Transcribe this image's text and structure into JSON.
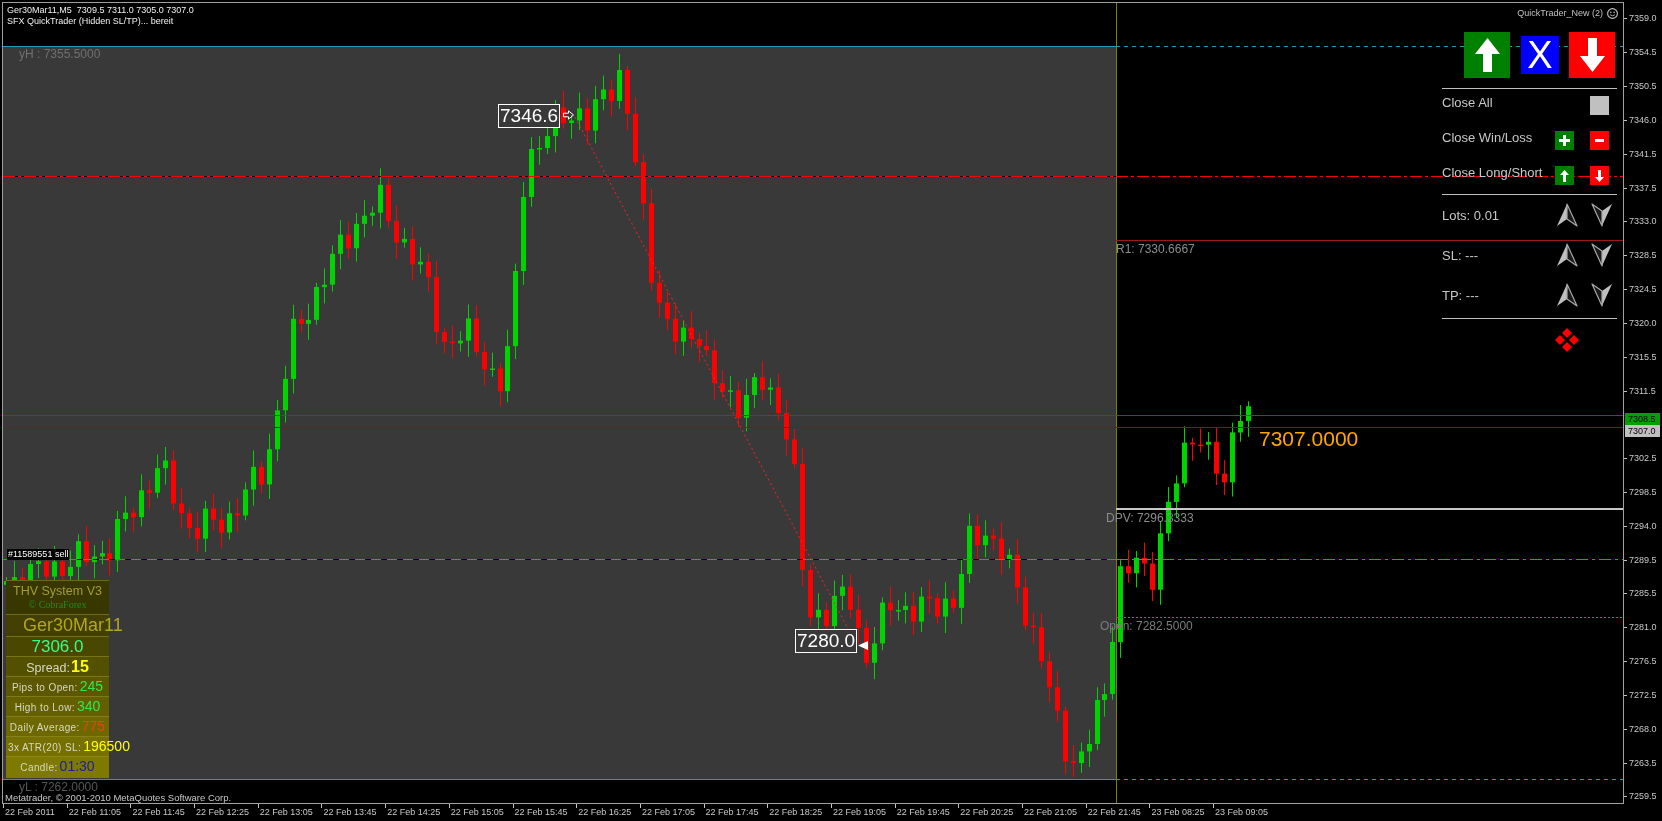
{
  "chart": {
    "title": "Ger30Mar11,M5  7309.5 7311.0 7305.0 7307.0",
    "status": "SFX QuickTrader (Hidden SL/TP)... bereit"
  },
  "quicktrader": {
    "title": "QuickTrader_New (2)",
    "close_label": "X",
    "rows": [
      {
        "kind": "close_all",
        "label": "Close All"
      },
      {
        "kind": "close_win_loss",
        "label": "Close Win/Loss"
      },
      {
        "kind": "close_long_short",
        "label": "Close Long/Short"
      },
      {
        "kind": "stepper",
        "label": "Lots: 0.01"
      },
      {
        "kind": "stepper",
        "label": "SL: ---"
      },
      {
        "kind": "stepper",
        "label": "TP: ---"
      }
    ]
  },
  "level_labels": [
    {
      "kind": "high",
      "label": "yH : 7355.5000"
    },
    {
      "kind": "r1",
      "label": "R1: 7330.6667"
    },
    {
      "kind": "dpv",
      "label": "DPV: 7296.3333"
    },
    {
      "kind": "open",
      "label": "Open: 7282.5000"
    },
    {
      "kind": "low",
      "label": "yL : 7262.0000"
    }
  ],
  "trade_marks": [
    {
      "kind": "entry",
      "label": "7346.6"
    },
    {
      "kind": "exit",
      "label": "7280.0"
    }
  ],
  "current_price": "7307.0000",
  "order_label": "#11589551 sell",
  "thv": {
    "title": "THV System V3",
    "subtitle": "© CobraForex",
    "symbol": "Ger30Mar11",
    "price": "7306.0",
    "rows": [
      {
        "kind": "major",
        "label": "Spread:",
        "value": "15",
        "color": "#ffff00"
      },
      {
        "kind": "stat",
        "label": "Pips to Open:",
        "value": "245",
        "color": "#32e650"
      },
      {
        "kind": "stat",
        "label": "High to Low:",
        "value": "340",
        "color": "#32e650"
      },
      {
        "kind": "stat",
        "label": "Daily Average:",
        "value": "775",
        "color": "#e8431a"
      },
      {
        "kind": "stat",
        "label": "3x ATR(20) SL:",
        "value": "196500",
        "color": "#ffff00"
      },
      {
        "kind": "stat",
        "label": "Candle:",
        "value": "01:30",
        "color": "#1c1c9c"
      }
    ]
  },
  "copyright": "Metatrader, © 2001-2010 MetaQuotes Software Corp.",
  "price_axis": [
    {
      "kind": "tick",
      "label": "7359.0"
    },
    {
      "kind": "tick",
      "label": "7354.5"
    },
    {
      "kind": "tick",
      "label": "7350.5"
    },
    {
      "kind": "tick",
      "label": "7346.0"
    },
    {
      "kind": "tick",
      "label": "7341.5"
    },
    {
      "kind": "tick",
      "label": "7337.5"
    },
    {
      "kind": "tick",
      "label": "7333.0"
    },
    {
      "kind": "tick",
      "label": "7328.5"
    },
    {
      "kind": "tick",
      "label": "7324.5"
    },
    {
      "kind": "tick",
      "label": "7320.0"
    },
    {
      "kind": "tick",
      "label": "7315.5"
    },
    {
      "kind": "tick",
      "label": "7311.5"
    },
    {
      "kind": "tag",
      "label": "7308.5",
      "color": "#00a000"
    },
    {
      "kind": "tag",
      "label": "7307.0",
      "color": "#c0c0c0"
    },
    {
      "kind": "tick",
      "label": "7302.5"
    },
    {
      "kind": "tick",
      "label": "7298.5"
    },
    {
      "kind": "tick",
      "label": "7294.0"
    },
    {
      "kind": "tick",
      "label": "7289.5"
    },
    {
      "kind": "tick",
      "label": "7285.5"
    },
    {
      "kind": "tick",
      "label": "7281.0"
    },
    {
      "kind": "tick",
      "label": "7276.5"
    },
    {
      "kind": "tick",
      "label": "7272.5"
    },
    {
      "kind": "tick",
      "label": "7268.0"
    },
    {
      "kind": "tick",
      "label": "7263.5"
    },
    {
      "kind": "tick",
      "label": "7259.5"
    }
  ],
  "time_axis": [
    "22 Feb 2011",
    "22 Feb 11:05",
    "22 Feb 11:45",
    "22 Feb 12:25",
    "22 Feb 13:05",
    "22 Feb 13:45",
    "22 Feb 14:25",
    "22 Feb 15:05",
    "22 Feb 15:45",
    "22 Feb 16:25",
    "22 Feb 17:05",
    "22 Feb 17:45",
    "22 Feb 18:25",
    "22 Feb 19:05",
    "22 Feb 19:45",
    "22 Feb 20:25",
    "22 Feb 21:05",
    "22 Feb 21:45",
    "23 Feb 08:25",
    "23 Feb 09:05"
  ]
}
